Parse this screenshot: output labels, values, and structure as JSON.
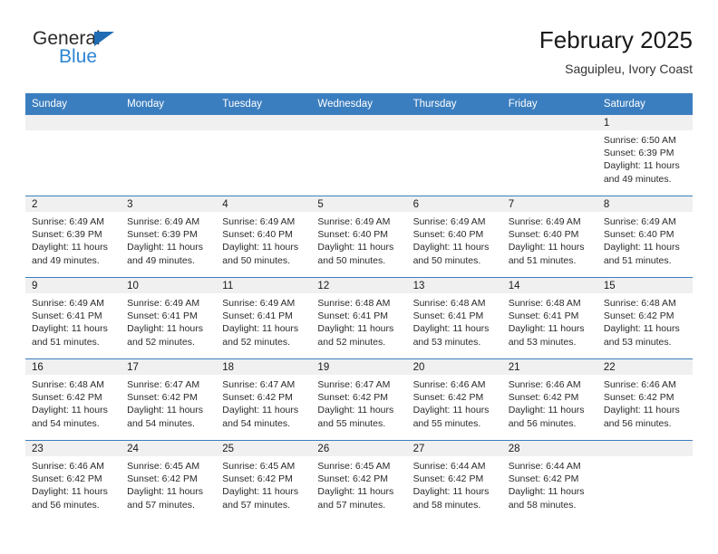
{
  "brand": {
    "name_part1": "General",
    "name_part2": "Blue",
    "triangle_color": "#1f6cb4",
    "blue_color": "#2e85d4"
  },
  "header": {
    "title": "February 2025",
    "subtitle": "Saguipleu, Ivory Coast",
    "header_bg": "#3b7ebf",
    "header_text_color": "#ffffff"
  },
  "weekdays": [
    "Sunday",
    "Monday",
    "Tuesday",
    "Wednesday",
    "Thursday",
    "Friday",
    "Saturday"
  ],
  "labels": {
    "sunrise_prefix": "Sunrise: ",
    "sunset_prefix": "Sunset: ",
    "daylight_prefix": "Daylight: "
  },
  "weeks": [
    [
      {
        "empty": true
      },
      {
        "empty": true
      },
      {
        "empty": true
      },
      {
        "empty": true
      },
      {
        "empty": true
      },
      {
        "empty": true
      },
      {
        "day": "1",
        "sunrise": "Sunrise: 6:50 AM",
        "sunset": "Sunset: 6:39 PM",
        "daylight": "Daylight: 11 hours and 49 minutes."
      }
    ],
    [
      {
        "day": "2",
        "sunrise": "Sunrise: 6:49 AM",
        "sunset": "Sunset: 6:39 PM",
        "daylight": "Daylight: 11 hours and 49 minutes."
      },
      {
        "day": "3",
        "sunrise": "Sunrise: 6:49 AM",
        "sunset": "Sunset: 6:39 PM",
        "daylight": "Daylight: 11 hours and 49 minutes."
      },
      {
        "day": "4",
        "sunrise": "Sunrise: 6:49 AM",
        "sunset": "Sunset: 6:40 PM",
        "daylight": "Daylight: 11 hours and 50 minutes."
      },
      {
        "day": "5",
        "sunrise": "Sunrise: 6:49 AM",
        "sunset": "Sunset: 6:40 PM",
        "daylight": "Daylight: 11 hours and 50 minutes."
      },
      {
        "day": "6",
        "sunrise": "Sunrise: 6:49 AM",
        "sunset": "Sunset: 6:40 PM",
        "daylight": "Daylight: 11 hours and 50 minutes."
      },
      {
        "day": "7",
        "sunrise": "Sunrise: 6:49 AM",
        "sunset": "Sunset: 6:40 PM",
        "daylight": "Daylight: 11 hours and 51 minutes."
      },
      {
        "day": "8",
        "sunrise": "Sunrise: 6:49 AM",
        "sunset": "Sunset: 6:40 PM",
        "daylight": "Daylight: 11 hours and 51 minutes."
      }
    ],
    [
      {
        "day": "9",
        "sunrise": "Sunrise: 6:49 AM",
        "sunset": "Sunset: 6:41 PM",
        "daylight": "Daylight: 11 hours and 51 minutes."
      },
      {
        "day": "10",
        "sunrise": "Sunrise: 6:49 AM",
        "sunset": "Sunset: 6:41 PM",
        "daylight": "Daylight: 11 hours and 52 minutes."
      },
      {
        "day": "11",
        "sunrise": "Sunrise: 6:49 AM",
        "sunset": "Sunset: 6:41 PM",
        "daylight": "Daylight: 11 hours and 52 minutes."
      },
      {
        "day": "12",
        "sunrise": "Sunrise: 6:48 AM",
        "sunset": "Sunset: 6:41 PM",
        "daylight": "Daylight: 11 hours and 52 minutes."
      },
      {
        "day": "13",
        "sunrise": "Sunrise: 6:48 AM",
        "sunset": "Sunset: 6:41 PM",
        "daylight": "Daylight: 11 hours and 53 minutes."
      },
      {
        "day": "14",
        "sunrise": "Sunrise: 6:48 AM",
        "sunset": "Sunset: 6:41 PM",
        "daylight": "Daylight: 11 hours and 53 minutes."
      },
      {
        "day": "15",
        "sunrise": "Sunrise: 6:48 AM",
        "sunset": "Sunset: 6:42 PM",
        "daylight": "Daylight: 11 hours and 53 minutes."
      }
    ],
    [
      {
        "day": "16",
        "sunrise": "Sunrise: 6:48 AM",
        "sunset": "Sunset: 6:42 PM",
        "daylight": "Daylight: 11 hours and 54 minutes."
      },
      {
        "day": "17",
        "sunrise": "Sunrise: 6:47 AM",
        "sunset": "Sunset: 6:42 PM",
        "daylight": "Daylight: 11 hours and 54 minutes."
      },
      {
        "day": "18",
        "sunrise": "Sunrise: 6:47 AM",
        "sunset": "Sunset: 6:42 PM",
        "daylight": "Daylight: 11 hours and 54 minutes."
      },
      {
        "day": "19",
        "sunrise": "Sunrise: 6:47 AM",
        "sunset": "Sunset: 6:42 PM",
        "daylight": "Daylight: 11 hours and 55 minutes."
      },
      {
        "day": "20",
        "sunrise": "Sunrise: 6:46 AM",
        "sunset": "Sunset: 6:42 PM",
        "daylight": "Daylight: 11 hours and 55 minutes."
      },
      {
        "day": "21",
        "sunrise": "Sunrise: 6:46 AM",
        "sunset": "Sunset: 6:42 PM",
        "daylight": "Daylight: 11 hours and 56 minutes."
      },
      {
        "day": "22",
        "sunrise": "Sunrise: 6:46 AM",
        "sunset": "Sunset: 6:42 PM",
        "daylight": "Daylight: 11 hours and 56 minutes."
      }
    ],
    [
      {
        "day": "23",
        "sunrise": "Sunrise: 6:46 AM",
        "sunset": "Sunset: 6:42 PM",
        "daylight": "Daylight: 11 hours and 56 minutes."
      },
      {
        "day": "24",
        "sunrise": "Sunrise: 6:45 AM",
        "sunset": "Sunset: 6:42 PM",
        "daylight": "Daylight: 11 hours and 57 minutes."
      },
      {
        "day": "25",
        "sunrise": "Sunrise: 6:45 AM",
        "sunset": "Sunset: 6:42 PM",
        "daylight": "Daylight: 11 hours and 57 minutes."
      },
      {
        "day": "26",
        "sunrise": "Sunrise: 6:45 AM",
        "sunset": "Sunset: 6:42 PM",
        "daylight": "Daylight: 11 hours and 57 minutes."
      },
      {
        "day": "27",
        "sunrise": "Sunrise: 6:44 AM",
        "sunset": "Sunset: 6:42 PM",
        "daylight": "Daylight: 11 hours and 58 minutes."
      },
      {
        "day": "28",
        "sunrise": "Sunrise: 6:44 AM",
        "sunset": "Sunset: 6:42 PM",
        "daylight": "Daylight: 11 hours and 58 minutes."
      },
      {
        "empty": true
      }
    ]
  ]
}
